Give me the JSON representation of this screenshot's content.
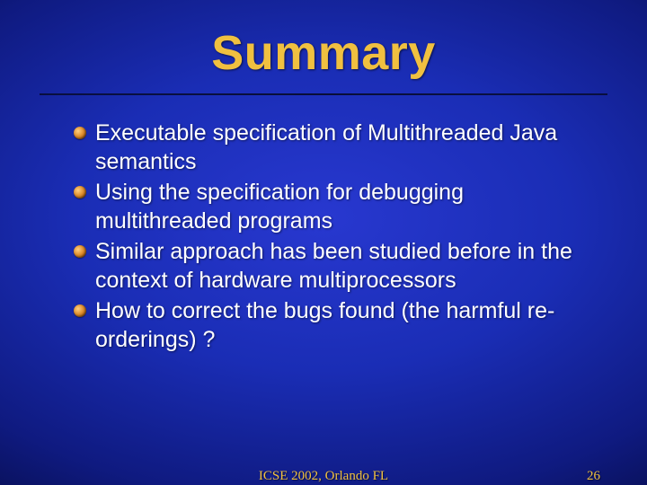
{
  "title": "Summary",
  "bullets": [
    "Executable specification of Multithreaded Java semantics",
    "Using the specification for debugging multithreaded programs",
    "Similar approach has been studied before in the context of hardware multiprocessors",
    "How to correct the bugs found (the harmful re-orderings) ?"
  ],
  "footer": {
    "venue": "ICSE 2002, Orlando FL",
    "page": "26"
  }
}
